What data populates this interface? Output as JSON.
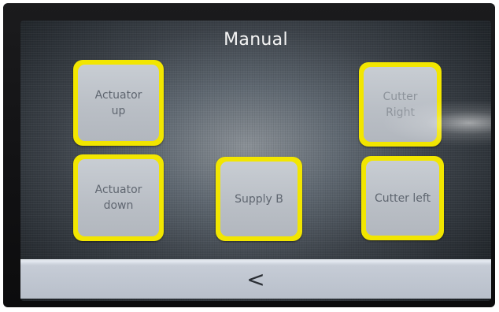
{
  "screen": {
    "title": "Manual"
  },
  "buttons": {
    "actuator_up": "Actuator\nup",
    "actuator_down": "Actuator\ndown",
    "supply_b": "Supply B",
    "cutter_right": "Cutter\nRight",
    "cutter_left": "Cutter left"
  },
  "nav": {
    "back_label": "<"
  },
  "colors": {
    "button_frame": "#f2e600",
    "button_face": "#bfc4cb",
    "nav_bar": "#bcc3ce"
  }
}
